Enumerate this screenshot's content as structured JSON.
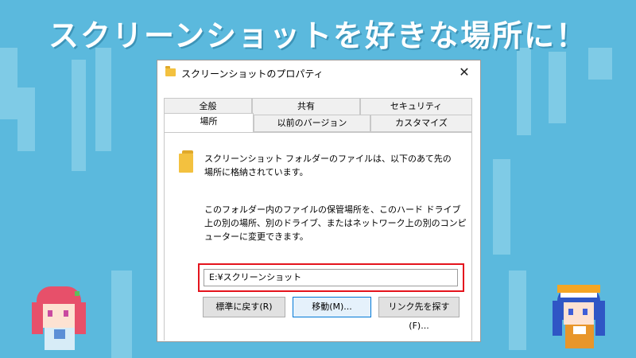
{
  "headline": "スクリーンショットを好きな場所に！",
  "window": {
    "title": "スクリーンショットのプロパティ",
    "close_glyph": "✕"
  },
  "tabs": {
    "row1": [
      {
        "label": "全般"
      },
      {
        "label": "共有"
      },
      {
        "label": "セキュリティ"
      }
    ],
    "row2": [
      {
        "label": "場所",
        "active": true
      },
      {
        "label": "以前のバージョン"
      },
      {
        "label": "カスタマイズ"
      }
    ]
  },
  "panel": {
    "description1": "スクリーンショット フォルダーのファイルは、以下のあて先の場所に格納されています。",
    "description2": "このフォルダー内のファイルの保管場所を、このハード ドライブ上の別の場所、別のドライブ、またはネットワーク上の別のコンピューターに変更できます。",
    "path_value": "E:¥スクリーンショット",
    "buttons": {
      "restore": "標準に戻す(R)",
      "move": "移動(M)...",
      "find_target": "リンク先を探す(F)..."
    }
  },
  "colors": {
    "background": "#5bb9dd",
    "highlight_border": "#e4141d",
    "folder": "#f3c13f"
  },
  "icons": {
    "title_folder": "folder-icon",
    "panel_folder": "folder-icon",
    "close": "close-icon"
  }
}
